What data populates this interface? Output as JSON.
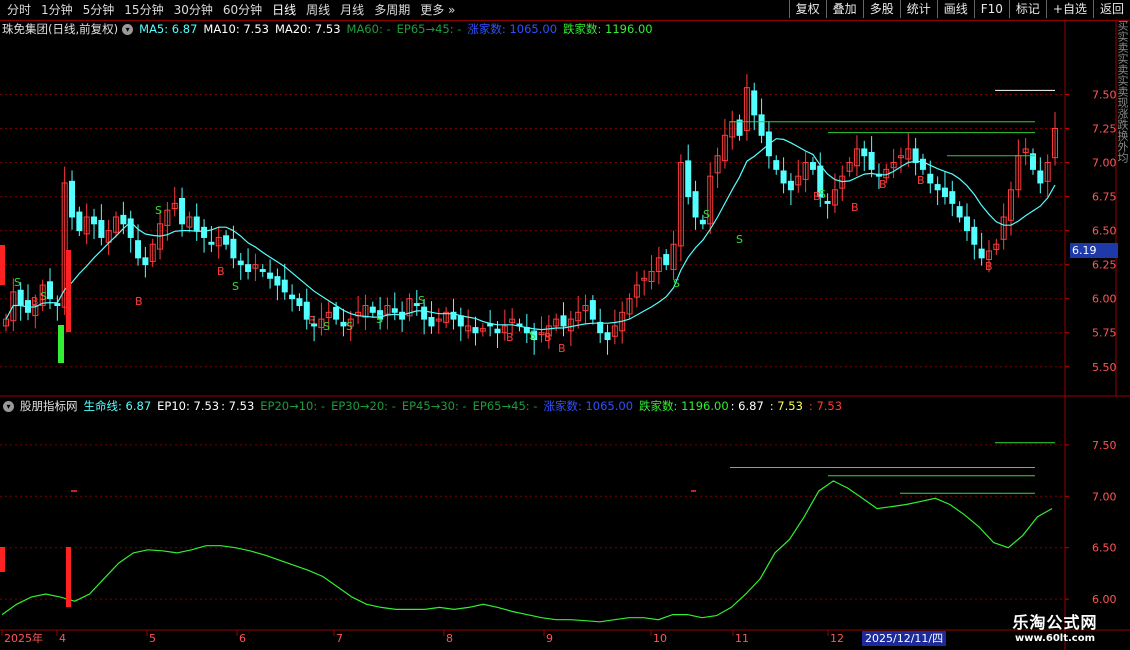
{
  "toolbar": {
    "periods": [
      "分时",
      "1分钟",
      "5分钟",
      "15分钟",
      "30分钟",
      "60分钟",
      "日线",
      "周线",
      "月线",
      "多周期",
      "更多"
    ],
    "active_period": "日线",
    "right_buttons": [
      "复权",
      "叠加",
      "多股",
      "统计",
      "画线",
      "F10",
      "标记",
      "+自选",
      "返回"
    ]
  },
  "main_info": {
    "title": "珠免集团(日线,前复权)",
    "ma5": "MA5: 6.87",
    "ma10": "MA10: 7.53",
    "ma20": "MA20: 7.53",
    "ma60": "MA60: -",
    "ep65": "EP65→45: -",
    "zhang": "涨家数: 1065.00",
    "die": "跌家数: 1196.00"
  },
  "indicator_info": {
    "title": "股朋指标网",
    "life": "生命线: 6.87",
    "ep10": "EP10: 7.53",
    "v1": ": 7.53",
    "ep20": "EP20→10: -",
    "ep30": "EP30→20: -",
    "ep45": "EP45→30: -",
    "ep65": "EP65→45: -",
    "zhang": "涨家数: 1065.00",
    "die": "跌家数: 1196.00",
    "v2": ": 6.87",
    "v3": ": 7.53",
    "v4": ": 7.53"
  },
  "sidebar_text": "买实卖实卖实卖现涨跌换外均",
  "price_tag": "6.19",
  "date_box": "2025/12/11/四",
  "watermark": {
    "line1": "乐淘公式网",
    "line2": "www.60lt.com"
  },
  "colors": {
    "up": "#ff3c3c",
    "down": "#54ffff",
    "buy_label": "#ff3c3c",
    "sell_label": "#33dd33",
    "life_line": "#33ee33",
    "grid": "#7a0000"
  },
  "chart_data": [
    {
      "type": "candlestick",
      "title": "珠免集团(日线,前复权)",
      "ylim": [
        5.3,
        7.9
      ],
      "y_ticks": [
        "7.50",
        "7.25",
        "7.00",
        "6.75",
        "6.50",
        "6.25",
        "6.00",
        "5.75",
        "5.50"
      ],
      "x_tick_labels": [
        "2025年",
        "4",
        "5",
        "6",
        "7",
        "8",
        "9",
        "10",
        "11",
        "12"
      ],
      "closes": [
        5.85,
        6.05,
        5.95,
        5.9,
        5.95,
        6.1,
        6.0,
        5.95,
        6.85,
        6.6,
        6.5,
        6.6,
        6.55,
        6.45,
        6.5,
        6.6,
        6.55,
        6.45,
        6.3,
        6.25,
        6.4,
        6.55,
        6.65,
        6.7,
        6.55,
        6.6,
        6.5,
        6.45,
        6.4,
        6.45,
        6.4,
        6.3,
        6.25,
        6.2,
        6.25,
        6.2,
        6.15,
        6.1,
        6.05,
        6.0,
        5.95,
        5.85,
        5.8,
        5.85,
        5.9,
        5.85,
        5.8,
        5.85,
        5.9,
        5.95,
        5.9,
        5.85,
        5.95,
        5.9,
        5.85,
        6.0,
        5.95,
        5.85,
        5.8,
        5.85,
        5.9,
        5.85,
        5.8,
        5.8,
        5.75,
        5.78,
        5.8,
        5.75,
        5.8,
        5.85,
        5.8,
        5.75,
        5.7,
        5.75,
        5.8,
        5.85,
        5.8,
        5.85,
        5.9,
        5.95,
        5.85,
        5.75,
        5.7,
        5.8,
        5.9,
        6.0,
        6.1,
        6.15,
        6.2,
        6.3,
        6.25,
        6.4,
        7.0,
        6.75,
        6.6,
        6.55,
        6.9,
        7.05,
        7.2,
        7.3,
        7.2,
        7.55,
        7.35,
        7.2,
        7.05,
        6.95,
        6.85,
        6.8,
        6.9,
        7.0,
        6.95,
        6.75,
        6.7,
        6.8,
        6.9,
        7.0,
        7.1,
        7.05,
        6.95,
        6.9,
        6.95,
        7.0,
        7.05,
        7.1,
        7.0,
        6.95,
        6.85,
        6.8,
        6.75,
        6.7,
        6.6,
        6.5,
        6.4,
        6.3,
        6.35,
        6.4,
        6.6,
        6.8,
        7.05,
        7.1,
        6.95,
        6.85,
        7.0,
        7.25
      ]
    },
    {
      "type": "line",
      "title": "股朋指标网",
      "ylim": [
        5.7,
        7.8
      ],
      "y_ticks": [
        "7.50",
        "7.00",
        "6.50",
        "6.00"
      ],
      "series": [
        {
          "name": "生命线",
          "values": [
            5.85,
            5.95,
            6.02,
            6.05,
            6.02,
            5.98,
            6.05,
            6.2,
            6.35,
            6.45,
            6.48,
            6.47,
            6.45,
            6.48,
            6.52,
            6.52,
            6.5,
            6.47,
            6.43,
            6.38,
            6.33,
            6.28,
            6.22,
            6.12,
            6.02,
            5.95,
            5.92,
            5.9,
            5.9,
            5.9,
            5.92,
            5.9,
            5.92,
            5.95,
            5.92,
            5.88,
            5.85,
            5.82,
            5.8,
            5.8,
            5.79,
            5.78,
            5.8,
            5.82,
            5.82,
            5.8,
            5.85,
            5.85,
            5.82,
            5.84,
            5.92,
            6.05,
            6.2,
            6.45,
            6.58,
            6.8,
            7.05,
            7.15,
            7.08,
            6.98,
            6.88,
            6.9,
            6.92,
            6.95,
            6.98,
            6.92,
            6.82,
            6.7,
            6.55,
            6.5,
            6.62,
            6.8,
            6.88
          ]
        }
      ]
    }
  ]
}
